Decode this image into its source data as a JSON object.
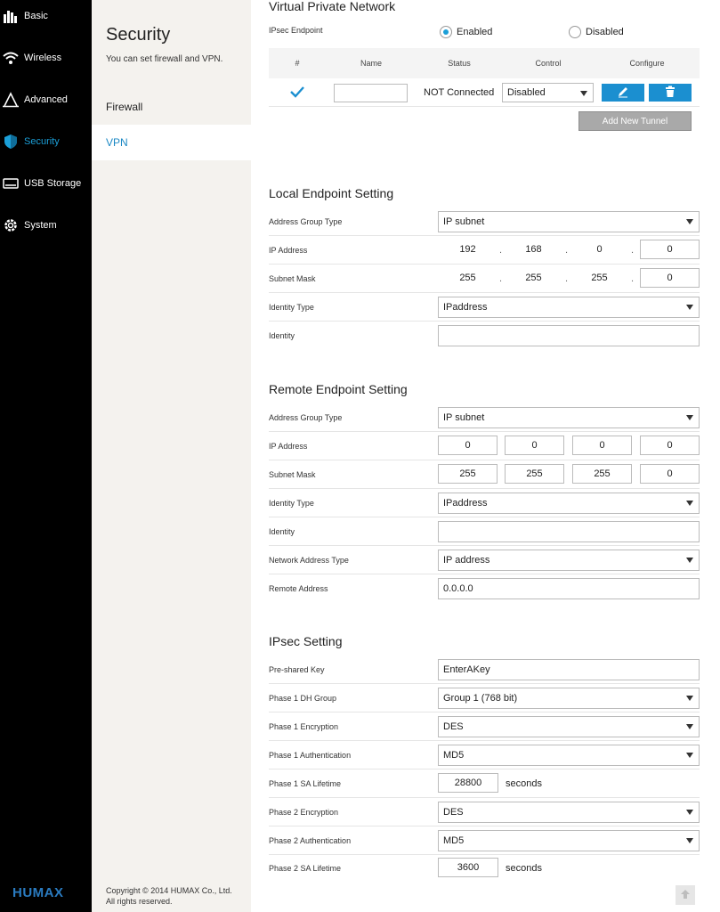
{
  "nav": {
    "items": [
      {
        "label": "Basic",
        "icon": "bar-chart-icon"
      },
      {
        "label": "Wireless",
        "icon": "wifi-icon"
      },
      {
        "label": "Advanced",
        "icon": "advanced-icon"
      },
      {
        "label": "Security",
        "icon": "shield-icon"
      },
      {
        "label": "USB Storage",
        "icon": "usb-storage-icon"
      },
      {
        "label": "System",
        "icon": "gear-icon"
      }
    ],
    "logo": "HUMAX",
    "active_color": "#1b9fd8"
  },
  "subnav": {
    "title": "Security",
    "description": "You can set firewall and VPN.",
    "items": [
      {
        "label": "Firewall"
      },
      {
        "label": "VPN"
      }
    ],
    "copyright_line1": "Copyright",
    "copyright_symbol": "©",
    "copyright_line1b": "2014 HUMAX Co., Ltd.",
    "copyright_line2": "All rights reserved."
  },
  "vpn": {
    "title": "Virtual Private Network",
    "endpoint_label": "IPsec Endpoint",
    "enabled_label": "Enabled",
    "disabled_label": "Disabled",
    "table": {
      "headers": [
        "#",
        "Name",
        "Status",
        "Control",
        "Configure"
      ],
      "row": {
        "name": "",
        "status": "NOT Connected",
        "control": "Disabled"
      }
    },
    "add_tunnel_label": "Add New Tunnel"
  },
  "local": {
    "title": "Local Endpoint Setting",
    "address_group_label": "Address Group Type",
    "address_group_value": "IP subnet",
    "ip_label": "IP Address",
    "ip": [
      "192",
      "168",
      "0",
      "0"
    ],
    "mask_label": "Subnet Mask",
    "mask": [
      "255",
      "255",
      "255",
      "0"
    ],
    "identity_type_label": "Identity Type",
    "identity_type_value": "IPaddress",
    "identity_label": "Identity",
    "identity_value": ""
  },
  "remote": {
    "title": "Remote Endpoint Setting",
    "address_group_label": "Address Group Type",
    "address_group_value": "IP subnet",
    "ip_label": "IP Address",
    "ip": [
      "0",
      "0",
      "0",
      "0"
    ],
    "mask_label": "Subnet Mask",
    "mask": [
      "255",
      "255",
      "255",
      "0"
    ],
    "identity_type_label": "Identity Type",
    "identity_type_value": "IPaddress",
    "identity_label": "Identity",
    "identity_value": "",
    "network_type_label": "Network Address Type",
    "network_type_value": "IP address",
    "remote_address_label": "Remote Address",
    "remote_address_value": "0.0.0.0"
  },
  "ipsec": {
    "title": "IPsec Setting",
    "psk_label": "Pre-shared Key",
    "psk_value": "EnterAKey",
    "p1_dh_label": "Phase 1 DH Group",
    "p1_dh_value": "Group 1 (768 bit)",
    "p1_enc_label": "Phase 1 Encryption",
    "p1_enc_value": "DES",
    "p1_auth_label": "Phase 1 Authentication",
    "p1_auth_value": "MD5",
    "p1_life_label": "Phase 1 SA Lifetime",
    "p1_life_value": "28800",
    "p2_enc_label": "Phase 2 Encryption",
    "p2_enc_value": "DES",
    "p2_auth_label": "Phase 2 Authentication",
    "p2_auth_value": "MD5",
    "p2_life_label": "Phase 2 SA Lifetime",
    "p2_life_value": "3600",
    "seconds_label": "seconds"
  }
}
